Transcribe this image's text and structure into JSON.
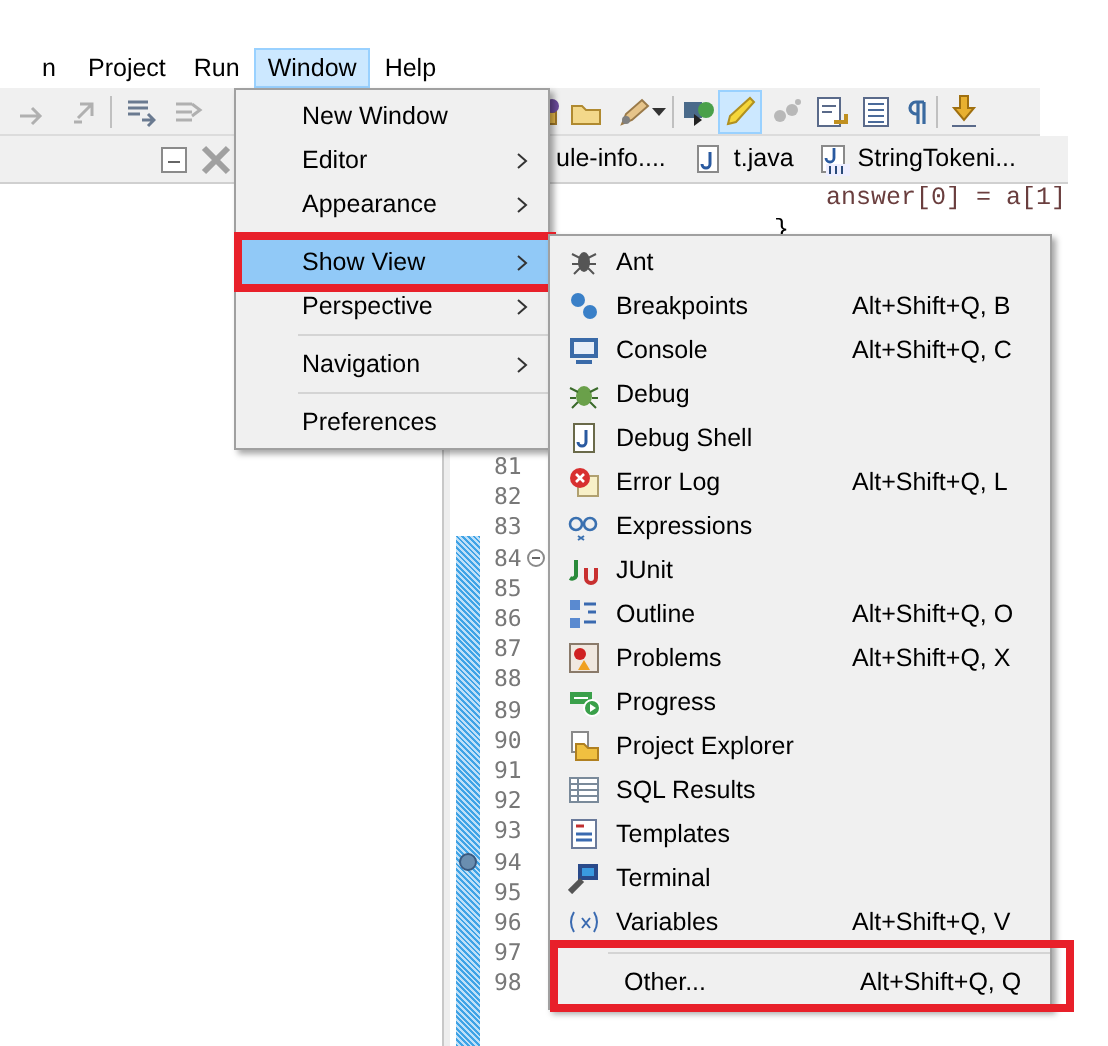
{
  "menu_bar": [
    {
      "label": "n",
      "selected": false
    },
    {
      "label": "Project",
      "selected": false
    },
    {
      "label": "Run",
      "selected": false
    },
    {
      "label": "Window",
      "selected": true
    },
    {
      "label": "Help",
      "selected": false
    }
  ],
  "editor_tabs": [
    {
      "label": "ule-info...."
    },
    {
      "label": "t.java"
    },
    {
      "label": "StringTokeni..."
    }
  ],
  "editor": {
    "code_lines": [
      "answer[0] = a[1]",
      "}"
    ],
    "line_numbers": [
      {
        "number": "81",
        "folding": false,
        "marker": false
      },
      {
        "number": "82",
        "folding": false,
        "marker": false
      },
      {
        "number": "83",
        "folding": false,
        "marker": false
      },
      {
        "number": "84",
        "folding": true,
        "marker": false
      },
      {
        "number": "85",
        "folding": false,
        "marker": false
      },
      {
        "number": "86",
        "folding": false,
        "marker": false
      },
      {
        "number": "87",
        "folding": false,
        "marker": false
      },
      {
        "number": "88",
        "folding": false,
        "marker": false
      },
      {
        "number": "89",
        "folding": false,
        "marker": false
      },
      {
        "number": "90",
        "folding": false,
        "marker": false
      },
      {
        "number": "91",
        "folding": false,
        "marker": false
      },
      {
        "number": "92",
        "folding": false,
        "marker": false
      },
      {
        "number": "93",
        "folding": false,
        "marker": false
      },
      {
        "number": "94",
        "folding": false,
        "marker": true
      },
      {
        "number": "95",
        "folding": false,
        "marker": false
      },
      {
        "number": "96",
        "folding": false,
        "marker": false
      },
      {
        "number": "97",
        "folding": false,
        "marker": false
      },
      {
        "number": "98",
        "folding": false,
        "marker": false
      }
    ]
  },
  "window_menu": {
    "items": [
      {
        "kind": "item",
        "label": "New Window",
        "submenu": false,
        "selected": false,
        "outlined": false
      },
      {
        "kind": "item",
        "label": "Editor",
        "submenu": true,
        "selected": false,
        "outlined": false
      },
      {
        "kind": "item",
        "label": "Appearance",
        "submenu": true,
        "selected": false,
        "outlined": false
      },
      {
        "kind": "separator"
      },
      {
        "kind": "item",
        "label": "Show View",
        "submenu": true,
        "selected": true,
        "outlined": true
      },
      {
        "kind": "item",
        "label": "Perspective",
        "submenu": true,
        "selected": false,
        "outlined": false
      },
      {
        "kind": "separator"
      },
      {
        "kind": "item",
        "label": "Navigation",
        "submenu": true,
        "selected": false,
        "outlined": false
      },
      {
        "kind": "separator"
      },
      {
        "kind": "item",
        "label": "Preferences",
        "submenu": false,
        "selected": false,
        "outlined": false
      }
    ]
  },
  "show_view_menu": {
    "items": [
      {
        "kind": "item",
        "label": "Ant",
        "outlined": false
      },
      {
        "kind": "item",
        "label": "Breakpoints",
        "shortcut": "Alt+Shift+Q, B",
        "outlined": false
      },
      {
        "kind": "item",
        "label": "Console",
        "shortcut": "Alt+Shift+Q, C",
        "outlined": false
      },
      {
        "kind": "item",
        "label": "Debug",
        "outlined": false
      },
      {
        "kind": "item",
        "label": "Debug Shell",
        "outlined": false
      },
      {
        "kind": "item",
        "label": "Error Log",
        "shortcut": "Alt+Shift+Q, L",
        "outlined": false
      },
      {
        "kind": "item",
        "label": "Expressions",
        "outlined": false
      },
      {
        "kind": "item",
        "label": "JUnit",
        "outlined": false
      },
      {
        "kind": "item",
        "label": "Outline",
        "shortcut": "Alt+Shift+Q, O",
        "outlined": false
      },
      {
        "kind": "item",
        "label": "Problems",
        "shortcut": "Alt+Shift+Q, X",
        "outlined": false
      },
      {
        "kind": "item",
        "label": "Progress",
        "outlined": false
      },
      {
        "kind": "item",
        "label": "Project Explorer",
        "outlined": false
      },
      {
        "kind": "item",
        "label": "SQL Results",
        "outlined": false
      },
      {
        "kind": "item",
        "label": "Templates",
        "outlined": false
      },
      {
        "kind": "item",
        "label": "Terminal",
        "outlined": false
      },
      {
        "kind": "item",
        "label": "Variables",
        "shortcut": "Alt+Shift+Q, V",
        "outlined": false
      },
      {
        "kind": "separator"
      },
      {
        "kind": "item",
        "label": "Other...",
        "shortcut": "Alt+Shift+Q, Q",
        "outlined": true
      }
    ]
  }
}
